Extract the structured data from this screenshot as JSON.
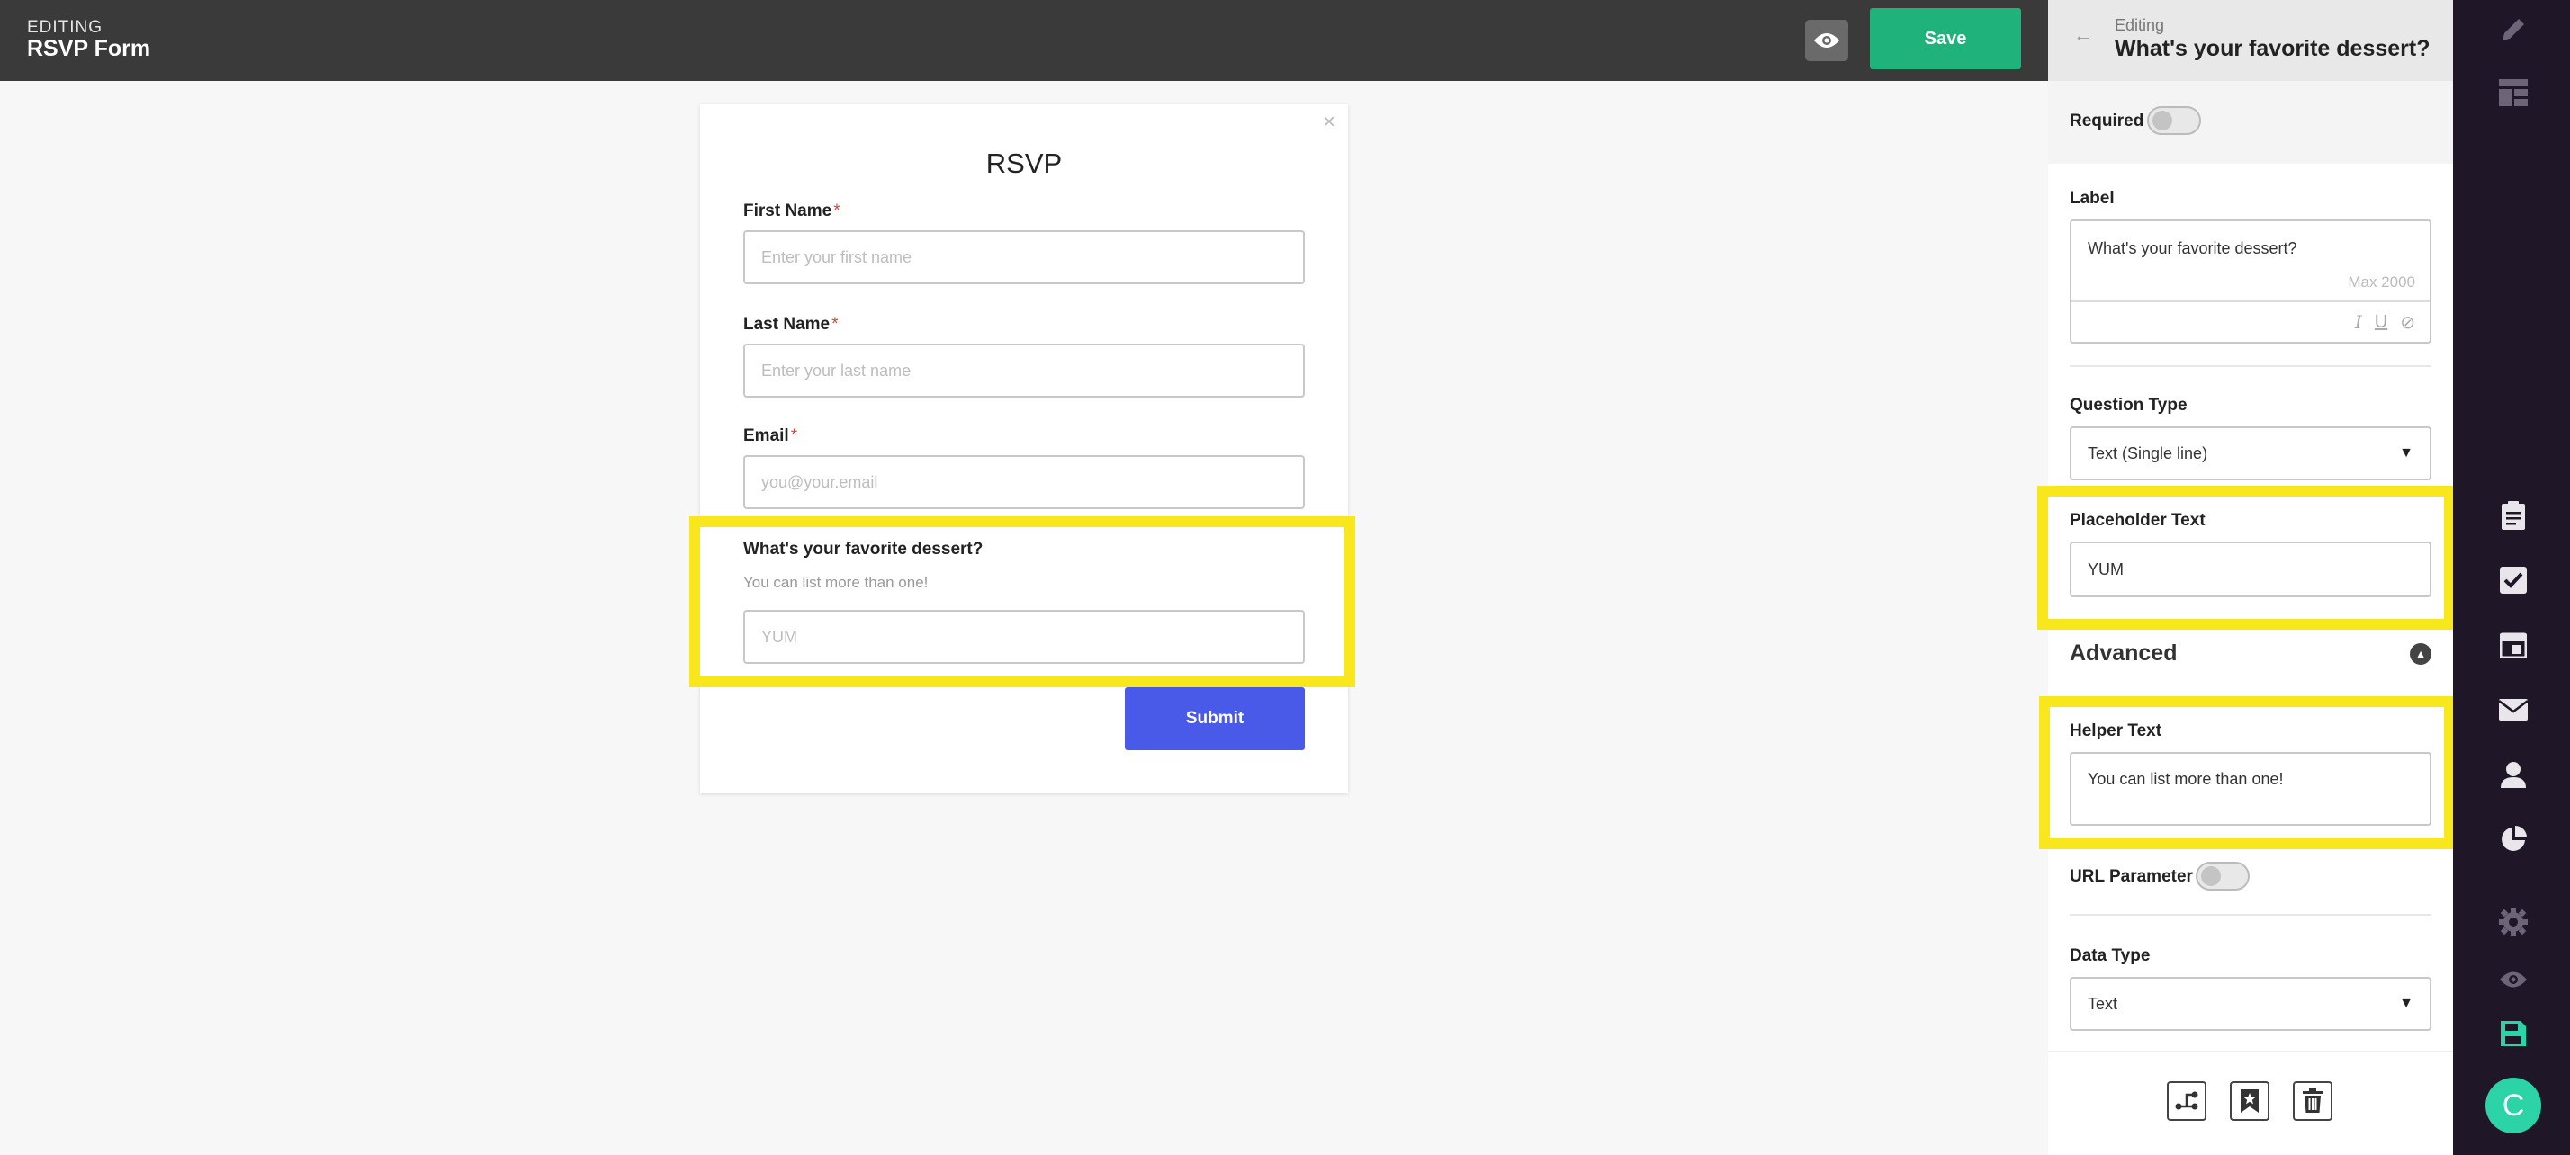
{
  "header": {
    "editing_label": "EDITING",
    "form_name": "RSVP Form",
    "save_label": "Save"
  },
  "form": {
    "title": "RSVP",
    "close_glyph": "×",
    "required_mark": "*",
    "fields": [
      {
        "label": "First Name",
        "required": true,
        "placeholder": "Enter your first name"
      },
      {
        "label": "Last Name",
        "required": true,
        "placeholder": "Enter your last name"
      },
      {
        "label": "Email",
        "required": true,
        "placeholder": "you@your.email"
      },
      {
        "label": "What's your favorite dessert?",
        "required": false,
        "helper": "You can list more than one!",
        "placeholder": "YUM"
      }
    ],
    "submit_label": "Submit"
  },
  "panel": {
    "back_glyph": "←",
    "editing_small": "Editing",
    "editing_title": "What's your favorite dessert?",
    "required_label": "Required",
    "label_heading": "Label",
    "label_value": "What's your favorite dessert?",
    "label_max": "Max 2000",
    "question_type_heading": "Question Type",
    "question_type_value": "Text (Single line)",
    "placeholder_heading": "Placeholder Text",
    "placeholder_value": "YUM",
    "advanced_heading": "Advanced",
    "helper_heading": "Helper Text",
    "helper_value": "You can list more than one!",
    "url_param_label": "URL Parameter",
    "data_type_heading": "Data Type",
    "data_type_value": "Text"
  },
  "colors": {
    "highlight": "#f8e71c",
    "save_green": "#1fb37b",
    "submit_blue": "#4a5ae8",
    "rail_bg": "#1f1728",
    "avatar_teal": "#2bd3a6"
  },
  "rail": {
    "avatar_letter": "C",
    "icons": [
      "pencil-icon",
      "layout-icon",
      "clipboard-icon",
      "checkbox-icon",
      "calendar-icon",
      "mail-icon",
      "user-icon",
      "pie-chart-icon",
      "gear-icon",
      "eye-icon",
      "save-icon"
    ]
  }
}
